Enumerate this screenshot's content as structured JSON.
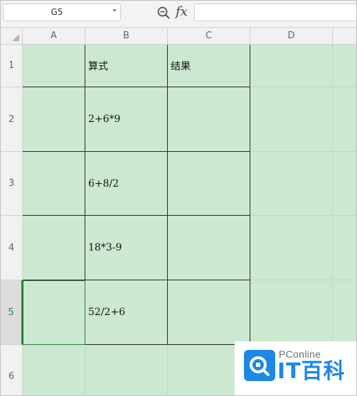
{
  "formula_bar": {
    "name_box": "G5",
    "fx_label": "fx",
    "formula_value": ""
  },
  "columns": [
    "A",
    "B",
    "C",
    "D"
  ],
  "rows": [
    "1",
    "2",
    "3",
    "4",
    "5",
    "6"
  ],
  "cells": {
    "B1": "算式",
    "C1": "结果",
    "B2": "2+6*9",
    "B3": "6+8/2",
    "B4": "18*3-9",
    "B5": "52/2+6"
  },
  "selected_cell": "A5",
  "watermark": {
    "top": "PConline",
    "main": "IT百科"
  },
  "colors": {
    "cell_fill": "#cde8d0",
    "header_bg": "#f1f1f1",
    "accent": "#2e7d32",
    "logo_blue": "#1e88e5"
  }
}
